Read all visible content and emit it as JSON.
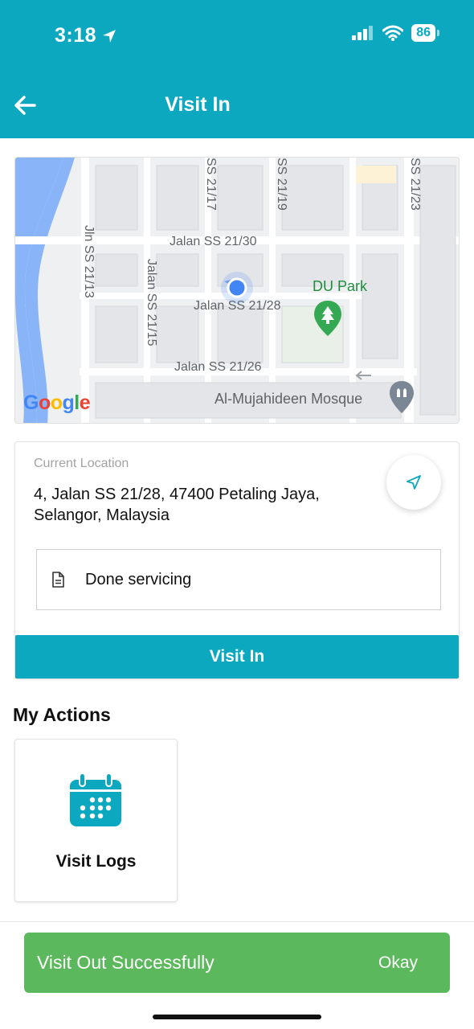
{
  "status_bar": {
    "time": "3:18",
    "battery": "86"
  },
  "header": {
    "title": "Visit In",
    "back_icon": "arrow-left-icon"
  },
  "map": {
    "labels": {
      "ss2117": "SS 21/17",
      "ss2119": "SS 21/19",
      "ss2123": "SS 21/23",
      "jln_ss2113": "Jln SS 21/13",
      "jalan_ss2115": "Jalan SS 21/15",
      "jalan_ss2130": "Jalan SS 21/30",
      "jalan_ss2128": "Jalan SS 21/28",
      "jalan_ss2126": "Jalan SS 21/26",
      "du_park": "DU Park",
      "mosque": "Al-Mujahideen Mosque"
    },
    "logo": "Google"
  },
  "location_card": {
    "label": "Current Location",
    "address": "4, Jalan SS 21/28, 47400 Petaling Jaya, Selangor, Malaysia",
    "note": "Done servicing",
    "submit": "Visit In"
  },
  "actions": {
    "title": "My Actions",
    "items": [
      {
        "label": "Visit Logs",
        "icon": "calendar-icon"
      }
    ]
  },
  "toast": {
    "message": "Visit Out Successfully",
    "action": "Okay"
  },
  "colors": {
    "primary": "#0ba8bf",
    "success": "#5cb85c"
  }
}
